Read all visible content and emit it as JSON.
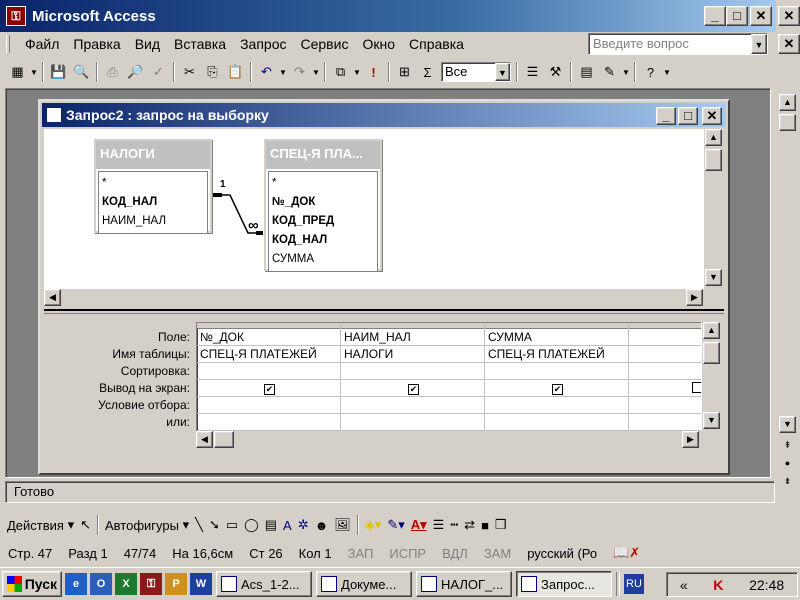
{
  "app": {
    "title": "Microsoft Access",
    "icon": "access-key-icon"
  },
  "menu": {
    "items": [
      "Файл",
      "Правка",
      "Вид",
      "Вставка",
      "Запрос",
      "Сервис",
      "Окно",
      "Справка"
    ]
  },
  "ask": {
    "placeholder": "Введите вопрос"
  },
  "toolbar": {
    "top_values": "Все"
  },
  "query_window": {
    "title": "Запрос2 : запрос на выборку"
  },
  "tables": [
    {
      "name": "НАЛОГИ",
      "fields": [
        "*",
        "КОД_НАЛ",
        "НАИМ_НАЛ"
      ],
      "bold": [
        false,
        true,
        false
      ]
    },
    {
      "name": "СПЕЦ-Я ПЛА...",
      "fields": [
        "*",
        "№_ДОК",
        "КОД_ПРЕД",
        "КОД_НАЛ",
        "СУММА"
      ],
      "bold": [
        false,
        true,
        true,
        true,
        false
      ]
    }
  ],
  "relation": {
    "one": "1",
    "many": "∞"
  },
  "grid": {
    "row_labels": [
      "Поле:",
      "Имя таблицы:",
      "Сортировка:",
      "Вывод на экран:",
      "Условие отбора:",
      "или:"
    ],
    "columns": [
      {
        "field": "№_ДОК",
        "table": "СПЕЦ-Я ПЛАТЕЖЕЙ",
        "show": true
      },
      {
        "field": "НАИМ_НАЛ",
        "table": "НАЛОГИ",
        "show": true
      },
      {
        "field": "СУММА",
        "table": "СПЕЦ-Я ПЛАТЕЖЕЙ",
        "show": true
      },
      {
        "field": "",
        "table": "",
        "show": false
      }
    ]
  },
  "status": {
    "text": "Готово"
  },
  "drawing": {
    "actions": "Действия",
    "autoshapes": "Автофигуры"
  },
  "word_status": {
    "page": "Стр. 47",
    "section": "Разд 1",
    "pages": "47/74",
    "at": "На 16,6см",
    "line": "Ст 26",
    "col": "Кол 1",
    "rec": "ЗАП",
    "trk": "ИСПР",
    "ext": "ВДЛ",
    "ovr": "ЗАМ",
    "lang": "русский (Ро"
  },
  "taskbar": {
    "start": "Пуск",
    "buttons": [
      "Acs_1-2...",
      "Докуме...",
      "НАЛОГ_...",
      "Запрос..."
    ],
    "lang": "RU",
    "time": "22:48"
  }
}
